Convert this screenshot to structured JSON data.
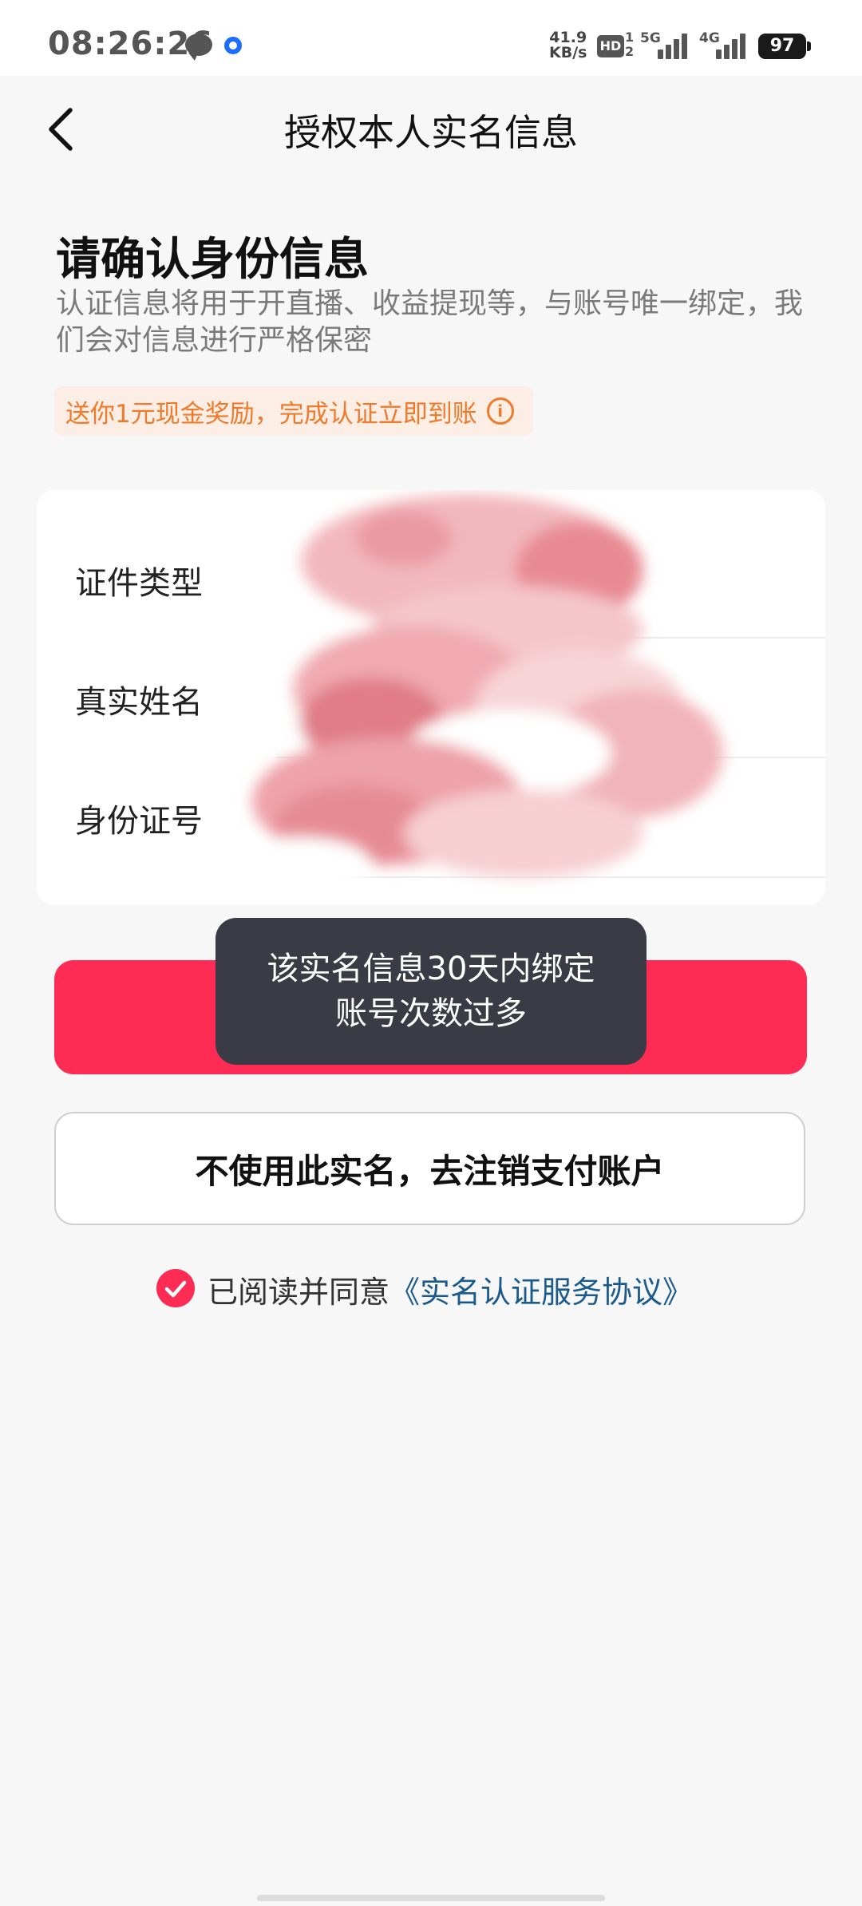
{
  "status_bar": {
    "time": "08:26:26",
    "speed_value": "41.9",
    "speed_unit": "KB/s",
    "hd": "HD",
    "sim_slots": "1\n2",
    "net1": "5G",
    "net2": "4G",
    "battery": "97",
    "icons": [
      "message-icon",
      "ring-icon",
      "signal-icon",
      "battery-icon"
    ]
  },
  "nav": {
    "title": "授权本人实名信息"
  },
  "header": {
    "title": "请确认身份信息",
    "description": "认证信息将用于开直播、收益提现等，与账号唯一绑定，我们会对信息进行严格保密",
    "promo": "送你1元现金奖励，完成认证立即到账",
    "promo_icon": "i"
  },
  "form": {
    "rows": [
      {
        "label": "证件类型"
      },
      {
        "label": "真实姓名"
      },
      {
        "label": "身份证号"
      }
    ]
  },
  "toast": {
    "line1": "该实名信息30天内绑定",
    "line2": "账号次数过多"
  },
  "secondary_button": {
    "label": "不使用此实名，去注销支付账户"
  },
  "agreement": {
    "prefix": "已阅读并同意",
    "link": "《实名认证服务协议》",
    "checked": true
  },
  "colors": {
    "accent": "#fe2c55",
    "promo_text": "#f07a2a",
    "link": "#1b5a8c",
    "toast_bg": "#3a3b44"
  }
}
